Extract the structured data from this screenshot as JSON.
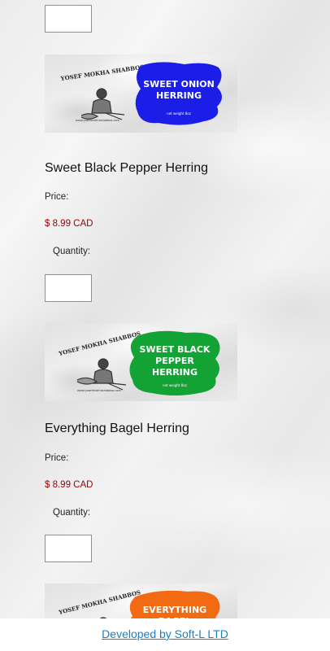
{
  "products": [
    {
      "image": {
        "brand": "YOSEF MOKHA SHABBOS",
        "banner": [
          "SWEET ONION",
          "HERRING"
        ],
        "banner_color": "#1a1ee6",
        "net_weight": "net weight 8oz"
      }
    },
    {
      "name": "Sweet Black Pepper Herring",
      "price_label": "Price:",
      "price": "$ 8.99 CAD",
      "quantity_label": "Quantity:",
      "image": {
        "brand": "YOSEF MOKHA SHABBOS",
        "banner": [
          "SWEET BLACK",
          "PEPPER",
          "HERRING"
        ],
        "banner_color": "#12a334",
        "net_weight": "net weight 8oz"
      }
    },
    {
      "name": "Everything Bagel Herring",
      "price_label": "Price:",
      "price": "$ 8.99 CAD",
      "quantity_label": "Quantity:",
      "image": {
        "brand": "YOSEF MOKHA SHABBOS",
        "banner": [
          "EVERYTHING",
          "BAGEL"
        ],
        "banner_color": "#f26a12"
      }
    }
  ],
  "footer": {
    "link": "Developed by Soft-L LTD"
  },
  "colors": {
    "price": "#a30000",
    "link": "#1a7fc0"
  }
}
